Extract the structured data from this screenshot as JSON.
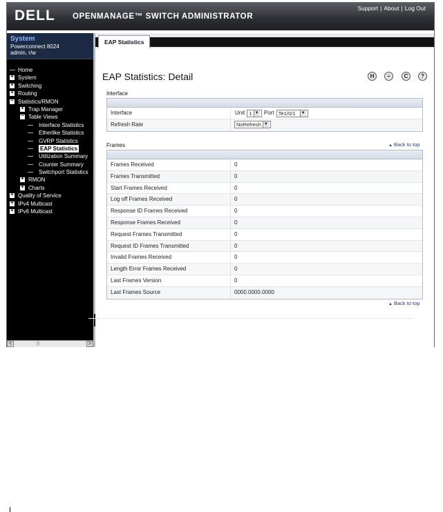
{
  "header": {
    "logo": "DELL",
    "app_title": "OPENMANAGE™ SWITCH ADMINISTRATOR",
    "links": [
      "Support",
      "About",
      "Log Out"
    ]
  },
  "system": {
    "title": "System",
    "model": "Powerconnect 8024",
    "user": "admin, r/w"
  },
  "tree": [
    {
      "label": "Home",
      "level": 0,
      "marker": "none"
    },
    {
      "label": "System",
      "level": 0,
      "marker": "plus"
    },
    {
      "label": "Switching",
      "level": 0,
      "marker": "plus"
    },
    {
      "label": "Routing",
      "level": 0,
      "marker": "plus"
    },
    {
      "label": "Statistics/RMON",
      "level": 0,
      "marker": "minus"
    },
    {
      "label": "Trap Manager",
      "level": 1,
      "marker": "plus"
    },
    {
      "label": "Table Views",
      "level": 1,
      "marker": "minus"
    },
    {
      "label": "Interface Statistics",
      "level": 2,
      "marker": "leaf"
    },
    {
      "label": "Etherlike Statistics",
      "level": 2,
      "marker": "leaf"
    },
    {
      "label": "GVRP Statistics",
      "level": 2,
      "marker": "leaf"
    },
    {
      "label": "EAP Statistics",
      "level": 2,
      "marker": "leaf",
      "selected": true
    },
    {
      "label": "Utilization Summary",
      "level": 2,
      "marker": "leaf"
    },
    {
      "label": "Counter Summary",
      "level": 2,
      "marker": "leaf"
    },
    {
      "label": "Switchport Statistics",
      "level": 2,
      "marker": "leaf"
    },
    {
      "label": "RMON",
      "level": 1,
      "marker": "plus"
    },
    {
      "label": "Charts",
      "level": 1,
      "marker": "plus"
    },
    {
      "label": "Quality of Service",
      "level": 0,
      "marker": "plus"
    },
    {
      "label": "IPv4 Multicast",
      "level": 0,
      "marker": "plus"
    },
    {
      "label": "IPv6 Multicast",
      "level": 0,
      "marker": "plus"
    }
  ],
  "tabs": {
    "active": "EAP Statistics"
  },
  "page": {
    "title": "EAP Statistics: Detail",
    "icons": [
      "save-icon",
      "print-icon",
      "refresh-icon",
      "help-icon"
    ]
  },
  "interface_section": {
    "title": "Interface",
    "interface_label": "Interface",
    "unit_label": "Unit",
    "unit_value": "1",
    "port_label": "Port",
    "port_value": "Te1/0/1",
    "refresh_label": "Refresh Rate",
    "refresh_value": "NoRefresh"
  },
  "frames_section": {
    "title": "Frames",
    "back_to_top": "Back to top",
    "rows": [
      {
        "label": "Frames Received",
        "value": "0"
      },
      {
        "label": "Frames Transmitted",
        "value": "0"
      },
      {
        "label": "Start Frames Received",
        "value": "0"
      },
      {
        "label": "Log off Frames Received",
        "value": "0"
      },
      {
        "label": "Response ID Frames Received",
        "value": "0"
      },
      {
        "label": "Response Frames Received",
        "value": "0"
      },
      {
        "label": "Request Frames Transmitted",
        "value": "0"
      },
      {
        "label": "Request ID Frames Transmitted",
        "value": "0"
      },
      {
        "label": "Invalid Frames Received",
        "value": "0"
      },
      {
        "label": "Length Error Frames Received",
        "value": "0"
      },
      {
        "label": "Last Frames Version",
        "value": "0"
      },
      {
        "label": "Last Frames Source",
        "value": "0000.0000.0000"
      }
    ]
  }
}
